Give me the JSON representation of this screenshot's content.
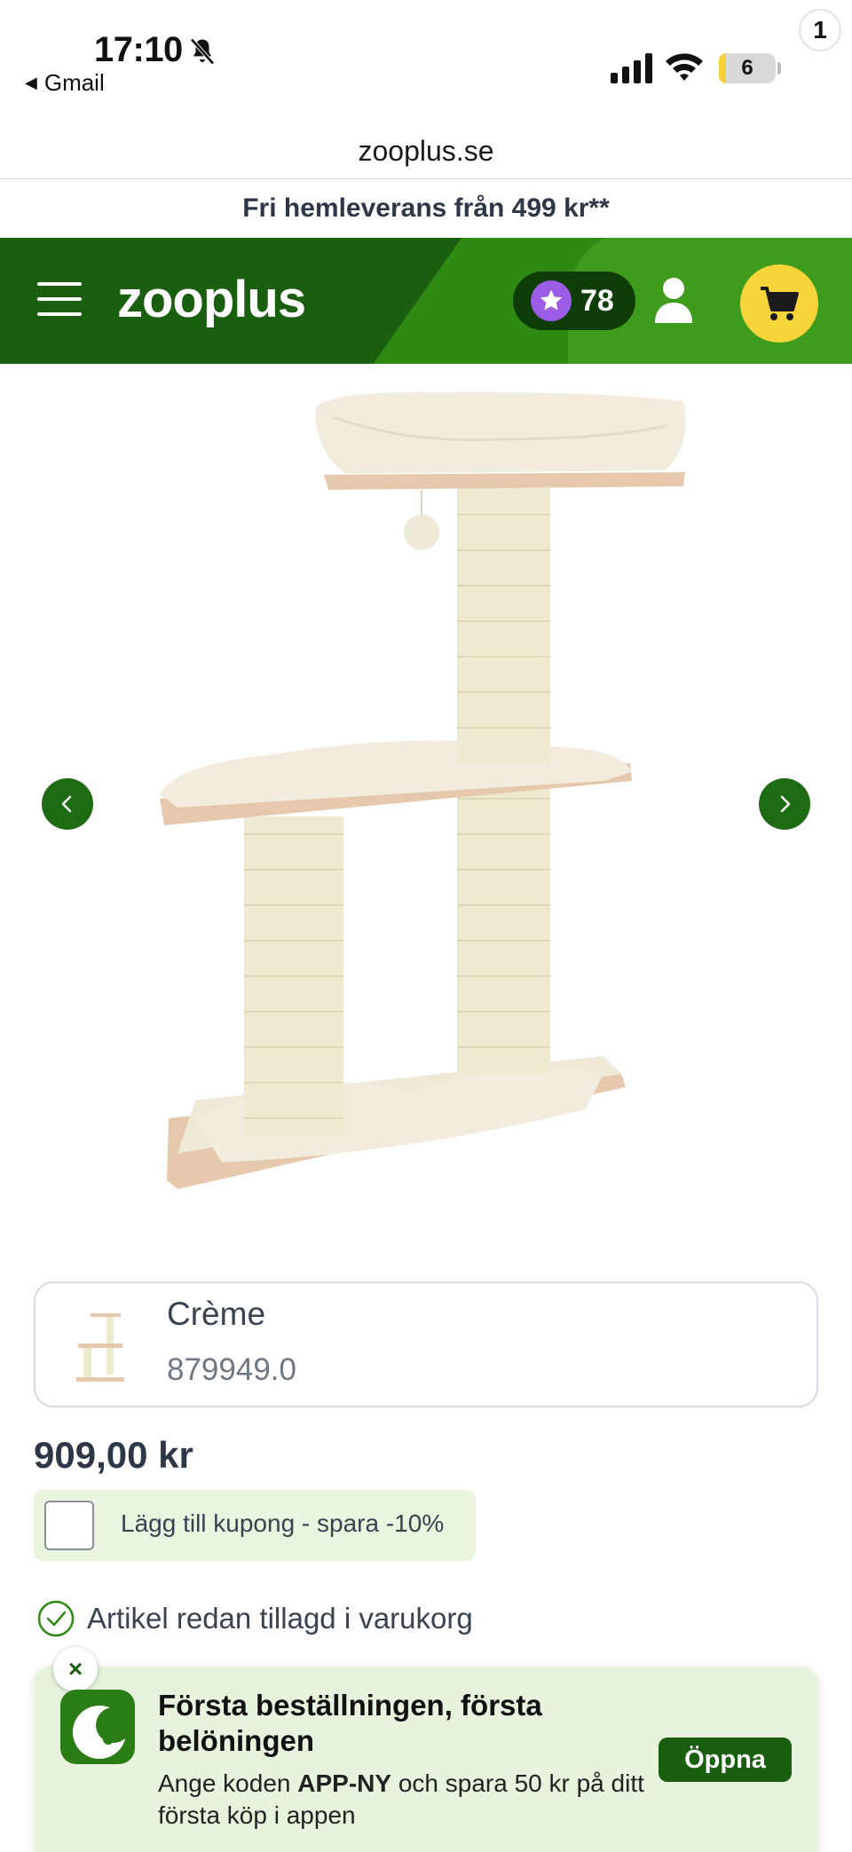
{
  "status_bar": {
    "time": "17:10",
    "back_app": "Gmail",
    "battery": "6",
    "icons": [
      "bell-slash-icon",
      "signal-icon",
      "wifi-icon",
      "battery-icon"
    ]
  },
  "browser": {
    "url": "zooplus.se"
  },
  "promo": {
    "text": "Fri hemleverans från 499 kr**"
  },
  "header": {
    "logo": "zooplus",
    "points": "78",
    "cart_count": "1",
    "icons": [
      "menu-icon",
      "star-icon",
      "user-icon",
      "cart-icon"
    ]
  },
  "gallery": {
    "icons": [
      "chevron-left-icon",
      "chevron-right-icon"
    ]
  },
  "variant": {
    "name": "Crème",
    "sku": "879949.0"
  },
  "price": "909,00 kr",
  "coupon": {
    "label": "Lägg till kupong - spara -10%"
  },
  "cart_status": {
    "text": "Artikel redan tillagd i varukorg"
  },
  "app_banner": {
    "title": "Första beställningen, första belöningen",
    "body_prefix": "Ange koden ",
    "code": "APP-NY",
    "body_suffix": " och spara 50 kr på ditt första köp i appen",
    "button": "Öppna",
    "close": "×"
  },
  "colors": {
    "brand_green": "#1a5e0f",
    "accent_green": "#3f9b1c",
    "cart_yellow": "#f7d43a",
    "points_purple": "#9b5ce6"
  }
}
